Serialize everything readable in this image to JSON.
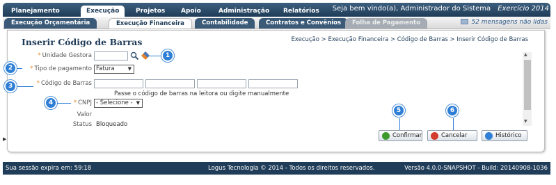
{
  "header": {
    "tabs": [
      "Planejamento",
      "Execução",
      "Projetos",
      "Apoio",
      "Administração",
      "Relatórios"
    ],
    "welcome": "Seja bem vindo(a), Administrador do Sistema",
    "exercise": "Exercício 2014"
  },
  "subnav": {
    "tabs": [
      "Execução Orçamentária",
      "Execução Financeira",
      "Contabilidade",
      "Contratos e Convênios",
      "Folha de Pagamento"
    ],
    "messages": "52 mensagens não lidas"
  },
  "page": {
    "title": "Inserir Código de Barras",
    "breadcrumb": "Execução > Execução Financeira > Código de Barras > Inserir Código de Barras"
  },
  "form": {
    "unidade_label": "Unidade Gestora",
    "unidade_value": "",
    "tipo_label": "Tipo de pagamento",
    "tipo_value": "Fatura",
    "codigo_label": "Código de Barras",
    "codigo_hint": "Passe o código de barras na leitora ou digite manualmente",
    "cnpj_label": "CNPJ",
    "cnpj_value": "- Selecione -",
    "valor_label": "Valor",
    "status_label": "Status",
    "status_value": "Bloqueado",
    "required_mark": "*"
  },
  "callouts": [
    "1",
    "2",
    "3",
    "4",
    "5",
    "6"
  ],
  "buttons": {
    "confirm": "Confirmar",
    "cancel": "Cancelar",
    "history": "Histórico"
  },
  "footer": {
    "session": "Sua sessão expira em: 59:18",
    "copyright": "Logus Tecnologia © 2014 - Todos os direitos reservados.",
    "version": "Versão 4.0.0-SNAPSHOT - Build: 20140908-1036"
  },
  "colors": {
    "accent": "#2f7fd6",
    "nav": "#1f3c58",
    "required": "#e08a2c"
  }
}
